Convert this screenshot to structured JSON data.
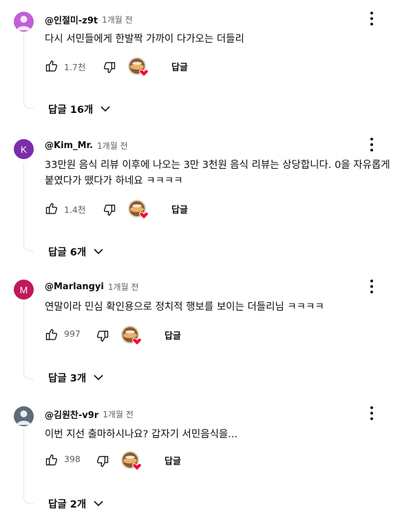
{
  "comments": [
    {
      "author": "@인절미-z9t",
      "time": "1개월 전",
      "text": "다시 서민들에게 한발짝 가까이 다가오는 더들리",
      "likes": "1.7천",
      "reply_label": "답글",
      "replies_label": "답글 16개",
      "avatar_letter": "",
      "avatar_color": "#c05fd6"
    },
    {
      "author": "@Kim_Mr.",
      "time": "1개월 전",
      "text": "33만원 음식 리뷰 이후에 나오는 3만 3천원 음식 리뷰는 상당합니다. 0을 자유롭게 붙였다가 뗐다가 하네요 ㅋㅋㅋㅋ",
      "likes": "1.4천",
      "reply_label": "답글",
      "replies_label": "답글 6개",
      "avatar_letter": "K",
      "avatar_color": "#7b2ea8"
    },
    {
      "author": "@Marlangyi",
      "time": "1개월 전",
      "text": "연말이라 민심 확인용으로 정치적 행보를 보이는 더들리님 ㅋㅋㅋㅋ",
      "likes": "997",
      "reply_label": "답글",
      "replies_label": "답글 3개",
      "avatar_letter": "M",
      "avatar_color": "#c2185b"
    },
    {
      "author": "@김원찬-v9r",
      "time": "1개월 전",
      "text": "이번 지선 출마하시나요? 갑자기 서민음식을...",
      "likes": "398",
      "reply_label": "답글",
      "replies_label": "답글 2개",
      "avatar_letter": "",
      "avatar_color": "#5f6b78"
    }
  ],
  "colors": {
    "heart": "#ff0033",
    "muted_text": "#606060",
    "line": "#e5e5e5"
  }
}
